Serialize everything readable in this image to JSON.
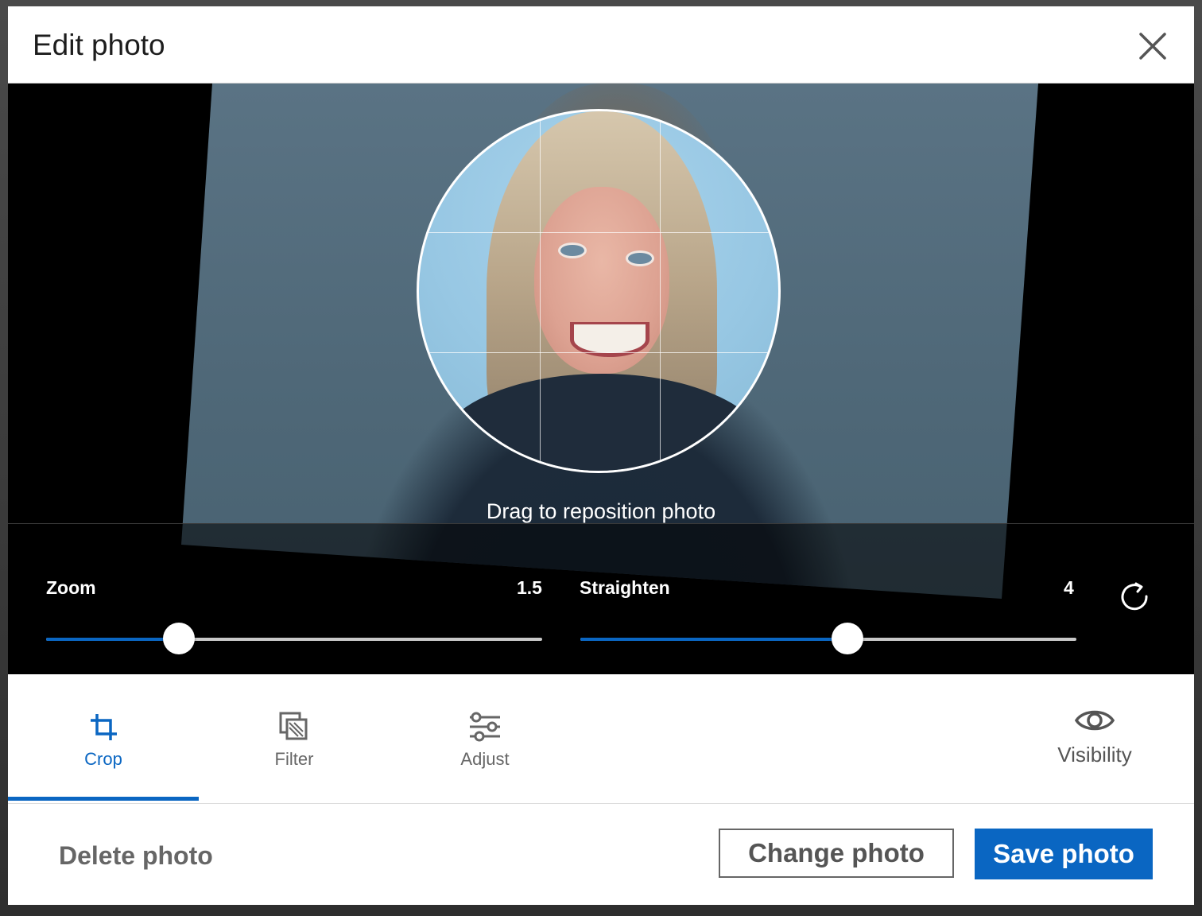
{
  "dialog": {
    "title": "Edit photo",
    "close_icon": "close-icon"
  },
  "editor": {
    "hint": "Drag to reposition photo",
    "zoom": {
      "label": "Zoom",
      "value": "1.5",
      "fraction": 0.267
    },
    "straighten": {
      "label": "Straighten",
      "value": "4",
      "fraction": 0.539
    },
    "rotate_icon": "rotate-icon"
  },
  "tabs": [
    {
      "label": "Crop",
      "icon": "crop-icon",
      "active": true
    },
    {
      "label": "Filter",
      "icon": "filter-icon",
      "active": false
    },
    {
      "label": "Adjust",
      "icon": "adjust-icon",
      "active": false
    }
  ],
  "visibility": {
    "label": "Visibility",
    "icon": "eye-icon"
  },
  "footer": {
    "delete_label": "Delete photo",
    "change_label": "Change photo",
    "save_label": "Save photo"
  },
  "colors": {
    "accent": "#0a66c2",
    "stage": "#000000",
    "track": "#c8c8c8"
  }
}
